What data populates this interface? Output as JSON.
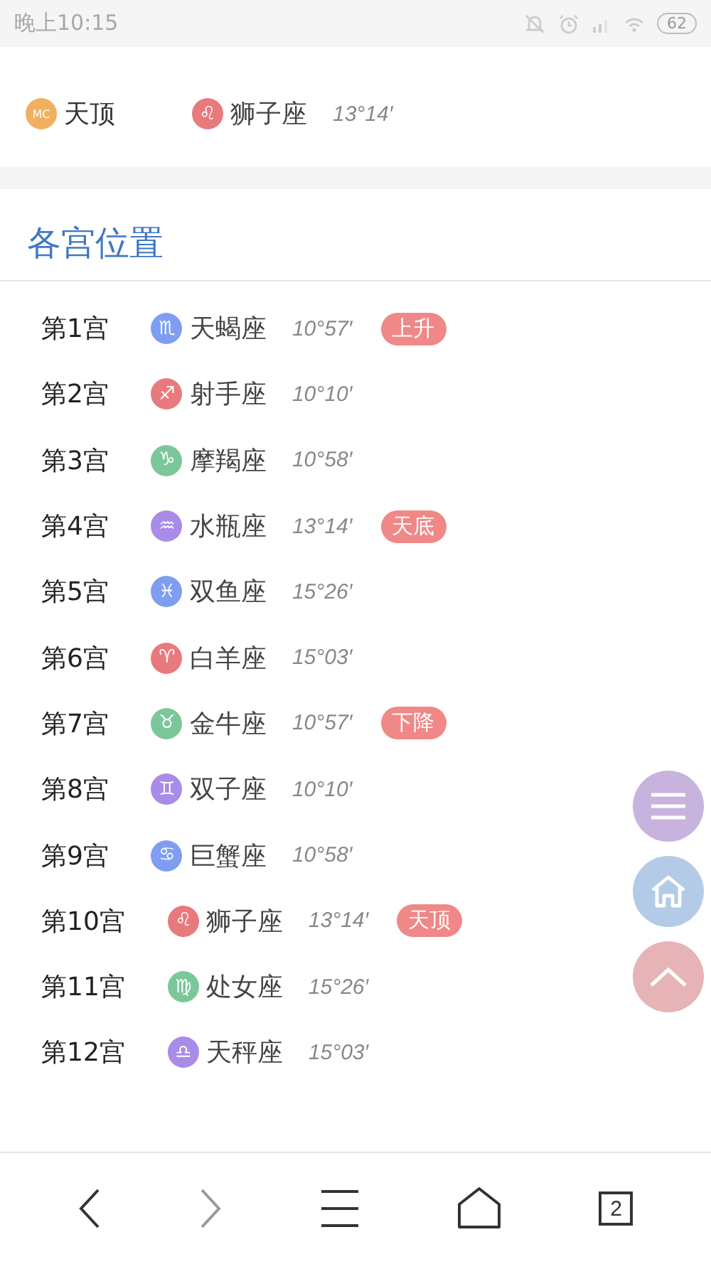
{
  "status_bar": {
    "time": "晚上10:15",
    "battery": "62"
  },
  "angle_row": {
    "badge": {
      "text": "MC",
      "color": "#f0b060"
    },
    "name": "天顶",
    "sign": {
      "symbol": "♌",
      "color": "#e87a7e",
      "name": "狮子座"
    },
    "degree": "13°14′"
  },
  "section": {
    "title": "各宫位置"
  },
  "houses": [
    {
      "house": "第1宫",
      "symbol": "♏",
      "color": "#7f9ef2",
      "sign": "天蝎座",
      "degree": "10°57′",
      "tag": "上升"
    },
    {
      "house": "第2宫",
      "symbol": "♐",
      "color": "#e87a7e",
      "sign": "射手座",
      "degree": "10°10′"
    },
    {
      "house": "第3宫",
      "symbol": "♑",
      "color": "#7cc79a",
      "sign": "摩羯座",
      "degree": "10°58′"
    },
    {
      "house": "第4宫",
      "symbol": "♒",
      "color": "#a98be8",
      "sign": "水瓶座",
      "degree": "13°14′",
      "tag": "天底"
    },
    {
      "house": "第5宫",
      "symbol": "♓",
      "color": "#7f9ef2",
      "sign": "双鱼座",
      "degree": "15°26′"
    },
    {
      "house": "第6宫",
      "symbol": "♈",
      "color": "#e87a7e",
      "sign": "白羊座",
      "degree": "15°03′"
    },
    {
      "house": "第7宫",
      "symbol": "♉",
      "color": "#7cc79a",
      "sign": "金牛座",
      "degree": "10°57′",
      "tag": "下降"
    },
    {
      "house": "第8宫",
      "symbol": "♊",
      "color": "#a98be8",
      "sign": "双子座",
      "degree": "10°10′"
    },
    {
      "house": "第9宫",
      "symbol": "♋",
      "color": "#7f9ef2",
      "sign": "巨蟹座",
      "degree": "10°58′"
    },
    {
      "house": "第10宫",
      "symbol": "♌",
      "color": "#e87a7e",
      "sign": "狮子座",
      "degree": "13°14′",
      "tag": "天顶"
    },
    {
      "house": "第11宫",
      "symbol": "♍",
      "color": "#7cc79a",
      "sign": "处女座",
      "degree": "15°26′"
    },
    {
      "house": "第12宫",
      "symbol": "♎",
      "color": "#a98be8",
      "sign": "天秤座",
      "degree": "15°03′"
    }
  ],
  "browser_bar": {
    "tab_count": "2"
  }
}
